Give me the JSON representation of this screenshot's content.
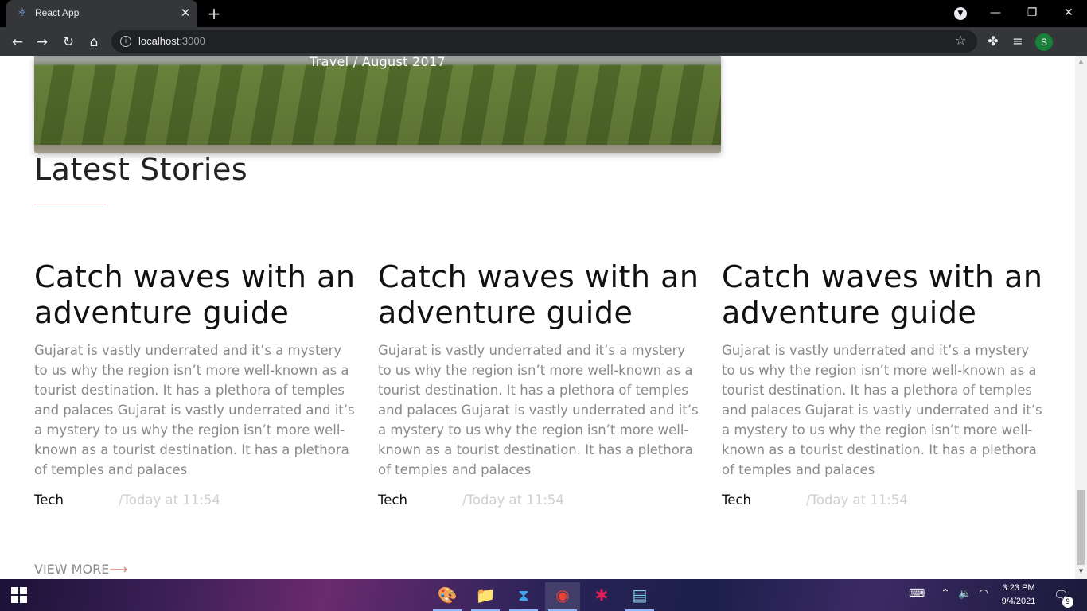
{
  "browser": {
    "tab_title": "React App",
    "tab_close": "✕",
    "new_tab": "+",
    "url_host": "localhost",
    "url_port": ":3000",
    "profile_initial": "S",
    "window": {
      "minimize": "—",
      "restore": "❐",
      "close": "✕"
    }
  },
  "hero": {
    "meta": "Travel / August 2017"
  },
  "section": {
    "title": "Latest Stories"
  },
  "cards": [
    {
      "title": "Catch waves with an adventure guide",
      "text": "Gujarat is vastly underrated and it’s a mystery to us why the region isn’t more well-known as a tourist destination. It has a plethora of temples and palaces Gujarat is vastly underrated and it’s a mystery to us why the region isn’t more well-known as a tourist destination. It has a plethora of temples and palaces",
      "category": "Tech",
      "date": "/Today at 11:54"
    },
    {
      "title": "Catch waves with an adventure guide",
      "text": "Gujarat is vastly underrated and it’s a mystery to us why the region isn’t more well-known as a tourist destination. It has a plethora of temples and palaces Gujarat is vastly underrated and it’s a mystery to us why the region isn’t more well-known as a tourist destination. It has a plethora of temples and palaces",
      "category": "Tech",
      "date": "/Today at 11:54"
    },
    {
      "title": "Catch waves with an adventure guide",
      "text": "Gujarat is vastly underrated and it’s a mystery to us why the region isn’t more well-known as a tourist destination. It has a plethora of temples and palaces Gujarat is vastly underrated and it’s a mystery to us why the region isn’t more well-known as a tourist destination. It has a plethora of temples and palaces",
      "category": "Tech",
      "date": "/Today at 11:54"
    }
  ],
  "view_more": {
    "label": "VIEW MORE",
    "arrow": "⟶"
  },
  "taskbar": {
    "time": "3:23 PM",
    "date": "9/4/2021",
    "notification_count": "9"
  },
  "colors": {
    "accent_line": "#d98a8a",
    "view_more_arrow": "#e07a7a",
    "meta_date": "#cfcfcf",
    "body_text": "#8a8a8a"
  }
}
